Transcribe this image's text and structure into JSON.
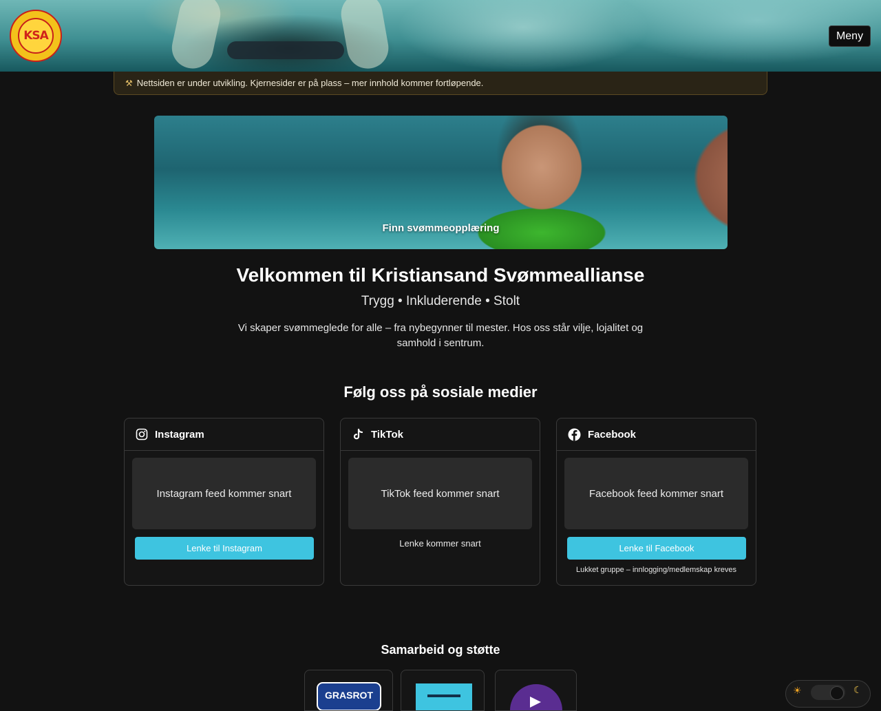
{
  "header": {
    "logo_text": "KSA",
    "menu_label": "Meny"
  },
  "notice": {
    "icon": "construction-icon",
    "text": "Nettsiden er under utvikling. Kjernesider er på plass – mer innhold kommer fortløpende."
  },
  "hero": {
    "label": "Finn svømmeopplæring"
  },
  "welcome": {
    "title": "Velkommen til Kristiansand Svømmeallianse",
    "tagline": "Trygg • Inkluderende • Stolt",
    "intro": "Vi skaper svømmeglede for alle – fra nybegynner til mester. Hos oss står vilje, lojalitet og samhold i sentrum."
  },
  "social": {
    "title": "Følg oss på sosiale medier",
    "cards": [
      {
        "name": "Instagram",
        "icon": "instagram-icon",
        "feed": "Instagram feed kommer snart",
        "link": "Lenke til Instagram"
      },
      {
        "name": "TikTok",
        "icon": "tiktok-icon",
        "feed": "TikTok feed kommer snart",
        "link_pending": "Lenke kommer snart"
      },
      {
        "name": "Facebook",
        "icon": "facebook-icon",
        "feed": "Facebook feed kommer snart",
        "link": "Lenke til Facebook",
        "note": "Lukket gruppe – innlogging/medlemskap kreves"
      }
    ]
  },
  "partners": {
    "title": "Samarbeid og støtte",
    "logos": [
      "GRASROT"
    ]
  },
  "colors": {
    "background": "#121212",
    "accent": "#3ec4e0",
    "notice_bg": "#2a2416"
  }
}
